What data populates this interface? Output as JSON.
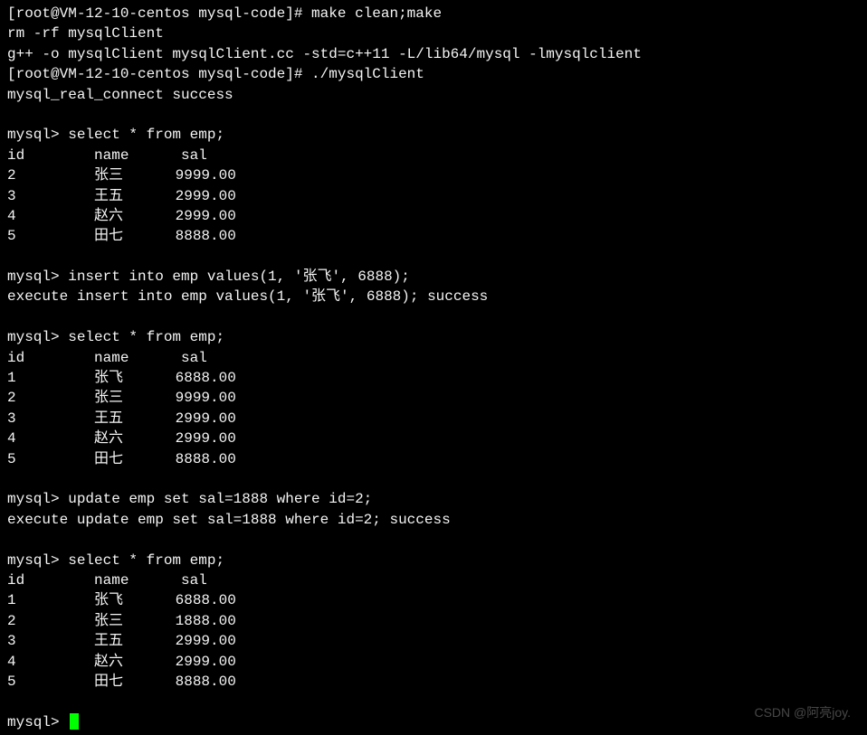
{
  "shell": {
    "promptHost": "[root@VM-12-10-centos mysql-code]#",
    "cmd1": "make clean;make",
    "out1a": "rm -rf mysqlClient",
    "out1b": "g++ -o mysqlClient mysqlClient.cc -std=c++11 -L/lib64/mysql -lmysqlclient",
    "cmd2": "./mysqlClient",
    "out2": "mysql_real_connect success"
  },
  "mysqlPrompt": "mysql>",
  "queries": {
    "select1": "select * from emp;",
    "table1": {
      "header": [
        "id",
        "name",
        "sal"
      ],
      "rows": [
        {
          "id": "2",
          "name": "张三",
          "sal": "9999.00"
        },
        {
          "id": "3",
          "name": "王五",
          "sal": "2999.00"
        },
        {
          "id": "4",
          "name": "赵六",
          "sal": "2999.00"
        },
        {
          "id": "5",
          "name": "田七",
          "sal": "8888.00"
        }
      ]
    },
    "insert": "insert into emp values(1, '张飞', 6888);",
    "insertExec": "execute insert into emp values(1, '张飞', 6888); success",
    "select2": "select * from emp;",
    "table2": {
      "header": [
        "id",
        "name",
        "sal"
      ],
      "rows": [
        {
          "id": "1",
          "name": "张飞",
          "sal": "6888.00"
        },
        {
          "id": "2",
          "name": "张三",
          "sal": "9999.00"
        },
        {
          "id": "3",
          "name": "王五",
          "sal": "2999.00"
        },
        {
          "id": "4",
          "name": "赵六",
          "sal": "2999.00"
        },
        {
          "id": "5",
          "name": "田七",
          "sal": "8888.00"
        }
      ]
    },
    "update": "update emp set sal=1888 where id=2;",
    "updateExec": "execute update emp set sal=1888 where id=2; success",
    "select3": "select * from emp;",
    "table3": {
      "header": [
        "id",
        "name",
        "sal"
      ],
      "rows": [
        {
          "id": "1",
          "name": "张飞",
          "sal": "6888.00"
        },
        {
          "id": "2",
          "name": "张三",
          "sal": "1888.00"
        },
        {
          "id": "3",
          "name": "王五",
          "sal": "2999.00"
        },
        {
          "id": "4",
          "name": "赵六",
          "sal": "2999.00"
        },
        {
          "id": "5",
          "name": "田七",
          "sal": "8888.00"
        }
      ]
    }
  },
  "watermark": "CSDN @阿亮joy."
}
